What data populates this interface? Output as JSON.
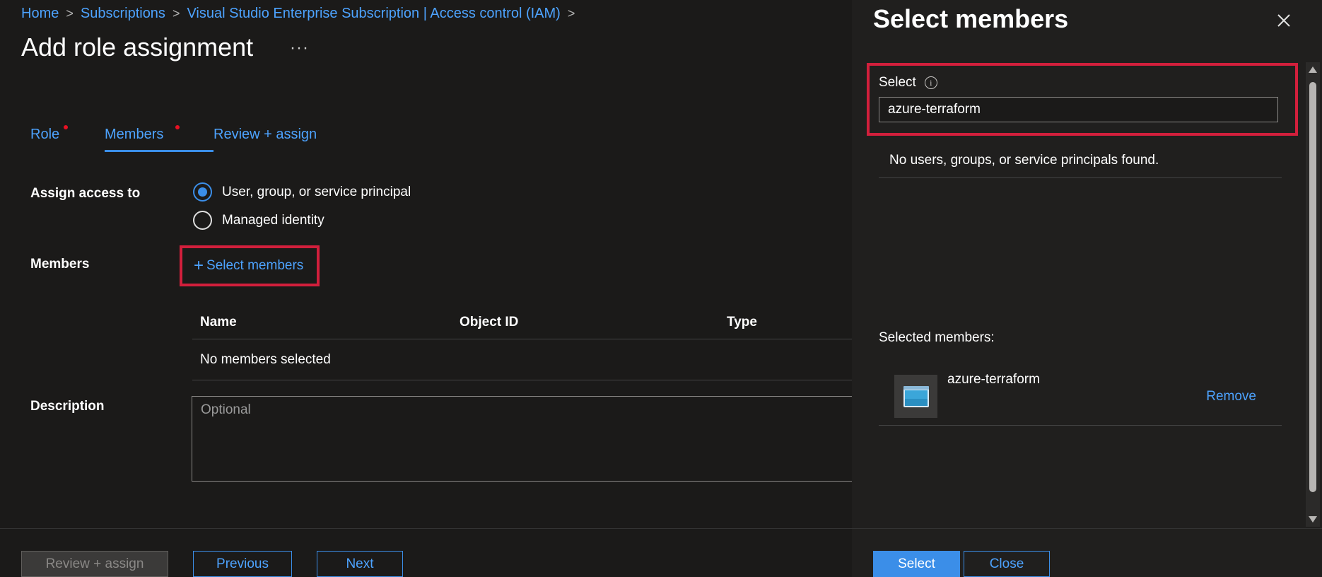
{
  "breadcrumb": [
    "Home",
    "Subscriptions",
    "Visual Studio Enterprise Subscription | Access control (IAM)"
  ],
  "page_title": "Add role assignment",
  "more_label": "···",
  "tabs": [
    {
      "label": "Role",
      "has_error_dot": true
    },
    {
      "label": "Members",
      "has_error_dot": true,
      "active": true
    },
    {
      "label": "Review + assign",
      "has_error_dot": false
    }
  ],
  "assign_access": {
    "label": "Assign access to",
    "options": [
      {
        "label": "User, group, or service principal",
        "selected": true
      },
      {
        "label": "Managed identity",
        "selected": false
      }
    ]
  },
  "members": {
    "label": "Members",
    "select_button": "Select members",
    "table": {
      "headers": [
        "Name",
        "Object ID",
        "Type"
      ],
      "empty_text": "No members selected"
    }
  },
  "description": {
    "label": "Description",
    "placeholder": "Optional"
  },
  "footer": {
    "review_assign": "Review + assign",
    "previous": "Previous",
    "next": "Next"
  },
  "panel": {
    "title": "Select members",
    "select_label": "Select",
    "search_value": "azure-terraform",
    "no_results": "No users, groups, or service principals found.",
    "selected_label": "Selected members:",
    "selected_members": [
      {
        "name": "azure-terraform",
        "remove_label": "Remove"
      }
    ],
    "select_button": "Select",
    "close_button": "Close"
  },
  "colors": {
    "accent": "#3b8ee8",
    "link": "#4da3ff",
    "highlight": "#d21f3c",
    "error_dot": "#e81123",
    "background": "#1b1a19",
    "panel_background": "#201f1e"
  }
}
